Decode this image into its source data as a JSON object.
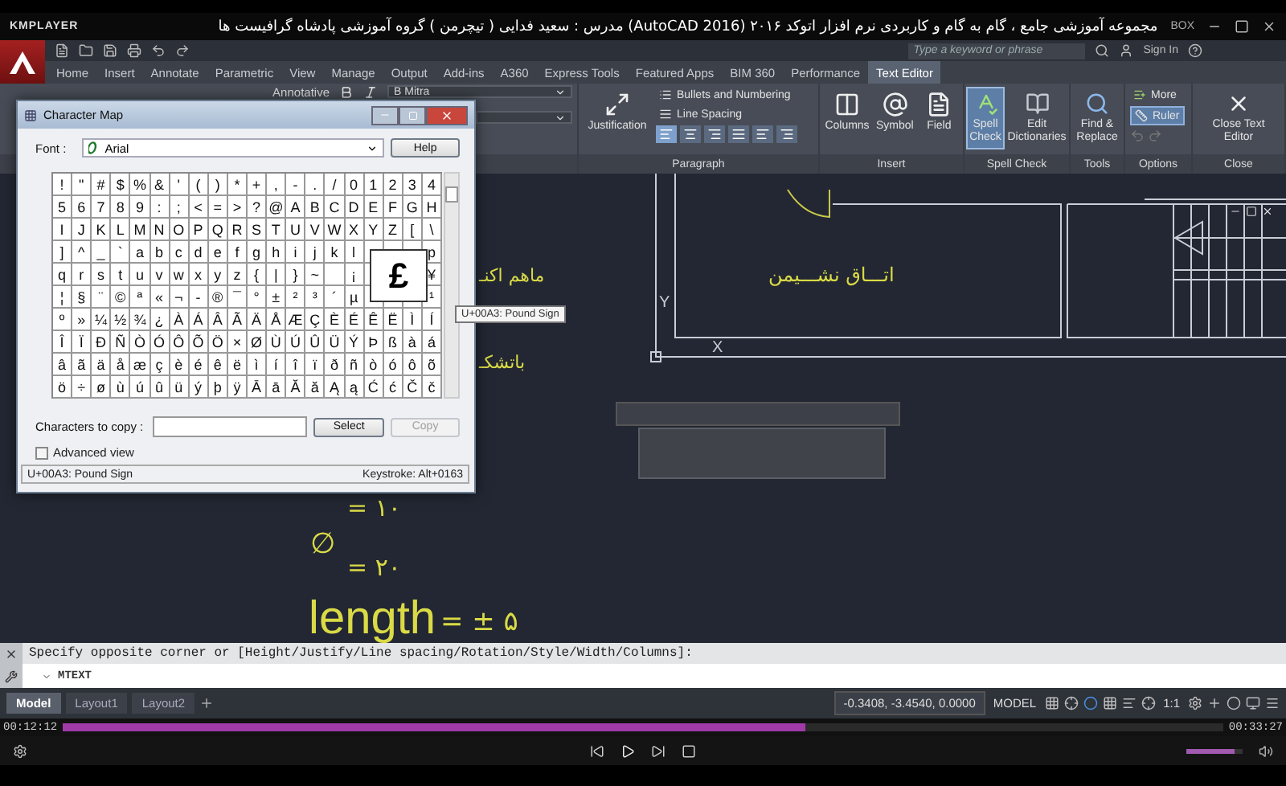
{
  "player": {
    "brand": "KMPLAYER",
    "title": "مجموعه آموزشی جامع ، گام به گام و کاربردی نرم افزار  اتوکد ۲۰۱۶ (AutoCAD 2016)  مدرس : سعید فدایی ( تیچرمن ) گروه آموزشی پادشاه گرافیست ها",
    "badge": "BOX",
    "current_time": "00:12:12",
    "total_time": "00:33:27",
    "progress": {
      "level": 0.64
    },
    "volume": {
      "level": 0.85
    }
  },
  "autocad_header": {
    "search": {
      "placeholder": "Type a keyword or phrase"
    },
    "sign_in": "Sign In"
  },
  "ribbon_tabs": [
    {
      "label": "Home",
      "selected": false
    },
    {
      "label": "Insert",
      "selected": false
    },
    {
      "label": "Annotate",
      "selected": false
    },
    {
      "label": "Parametric",
      "selected": false
    },
    {
      "label": "View",
      "selected": false
    },
    {
      "label": "Manage",
      "selected": false
    },
    {
      "label": "Output",
      "selected": false
    },
    {
      "label": "Add-ins",
      "selected": false
    },
    {
      "label": "A360",
      "selected": false
    },
    {
      "label": "Express Tools",
      "selected": false
    },
    {
      "label": "Featured Apps",
      "selected": false
    },
    {
      "label": "BIM 360",
      "selected": false
    },
    {
      "label": "Performance",
      "selected": false
    },
    {
      "label": "Text Editor",
      "selected": true
    }
  ],
  "ribbon": {
    "formatting": {
      "annotative": "Annotative",
      "font": "B Mitra"
    },
    "paragraph": {
      "title": "Paragraph",
      "justification": "Justification",
      "bullets": "Bullets and Numbering",
      "line_spacing": "Line Spacing",
      "alignments": [
        {
          "selected": true
        },
        {
          "selected": false
        },
        {
          "selected": false
        },
        {
          "selected": false
        },
        {
          "selected": false
        },
        {
          "selected": false
        }
      ]
    },
    "insert": {
      "title": "Insert",
      "buttons": [
        "Columns",
        "Symbol",
        "Field"
      ]
    },
    "spell_check": {
      "title": "Spell Check",
      "buttons": [
        {
          "label": "Spell Check",
          "selected": true
        },
        {
          "label": "Edit Dictionaries",
          "selected": false
        }
      ]
    },
    "tools": {
      "title": "Tools",
      "button": "Find & Replace"
    },
    "options": {
      "title": "Options",
      "more": "More",
      "ruler": {
        "label": "Ruler",
        "on": true
      }
    },
    "close": {
      "title": "Close",
      "button": "Close Text Editor"
    }
  },
  "drawing": {
    "room_label": "اتـــاق نشـــیمن",
    "side_texts": [
      "ماهم اکنـ",
      "باتشکـ"
    ],
    "ucs": {
      "y": "Y",
      "x": "X"
    },
    "values": [
      {
        "kind": "text",
        "text": "= ۱۰"
      },
      {
        "kind": "diameter",
        "symbol": "∅",
        "text": "= ۲۰"
      }
    ],
    "length": {
      "word": "length",
      "text": "= ± ۵"
    }
  },
  "character_map": {
    "title": "Character Map",
    "font_label": "Font :",
    "font": "Arial",
    "help": "Help",
    "rows": [
      [
        "!",
        "\"",
        "#",
        "$",
        "%",
        "&",
        "'",
        "(",
        ")",
        "*",
        "+",
        ",",
        "-",
        ".",
        "/",
        "0",
        "1",
        "2",
        "3",
        "4"
      ],
      [
        "5",
        "6",
        "7",
        "8",
        "9",
        ":",
        ";",
        "<",
        "=",
        ">",
        "?",
        "@",
        "A",
        "B",
        "C",
        "D",
        "E",
        "F",
        "G",
        "H"
      ],
      [
        "I",
        "J",
        "K",
        "L",
        "M",
        "N",
        "O",
        "P",
        "Q",
        "R",
        "S",
        "T",
        "U",
        "V",
        "W",
        "X",
        "Y",
        "Z",
        "[",
        "\\"
      ],
      [
        "]",
        "^",
        "_",
        "`",
        "a",
        "b",
        "c",
        "d",
        "e",
        "f",
        "g",
        "h",
        "i",
        "j",
        "k",
        "l",
        null,
        null,
        null,
        "p"
      ],
      [
        "q",
        "r",
        "s",
        "t",
        "u",
        "v",
        "w",
        "x",
        "y",
        "z",
        "{",
        "|",
        "}",
        "~",
        null,
        "¡",
        null,
        null,
        null,
        "¥"
      ],
      [
        "¦",
        "§",
        "¨",
        "©",
        "ª",
        "«",
        "¬",
        "-",
        "®",
        "¯",
        "°",
        "±",
        "²",
        "³",
        "´",
        "µ",
        null,
        null,
        null,
        "¹"
      ],
      [
        "º",
        "»",
        "¼",
        "½",
        "¾",
        "¿",
        "À",
        "Á",
        "Â",
        "Ã",
        "Ä",
        "Å",
        "Æ",
        "Ç",
        "È",
        "É",
        "Ê",
        "Ë",
        "Ì",
        "Í"
      ],
      [
        "Î",
        "Ï",
        "Ð",
        "Ñ",
        "Ò",
        "Ó",
        "Ô",
        "Õ",
        "Ö",
        "×",
        "Ø",
        "Ù",
        "Ú",
        "Û",
        "Ü",
        "Ý",
        "Þ",
        "ß",
        "à",
        "á"
      ],
      [
        "â",
        "ã",
        "ä",
        "å",
        "æ",
        "ç",
        "è",
        "é",
        "ê",
        "ë",
        "ì",
        "í",
        "î",
        "ï",
        "ð",
        "ñ",
        "ò",
        "ó",
        "ô",
        "õ"
      ],
      [
        "ö",
        "÷",
        "ø",
        "ù",
        "ú",
        "û",
        "ü",
        "ý",
        "þ",
        "ÿ",
        "Ā",
        "ā",
        "Ă",
        "ă",
        "Ą",
        "ą",
        "Ć",
        "ć",
        "Č",
        "č"
      ]
    ],
    "magnified": "£",
    "tooltip": "U+00A3: Pound Sign",
    "copy_label": "Characters to copy :",
    "select": "Select",
    "copy": {
      "label": "Copy",
      "disabled": true
    },
    "advanced_view": {
      "label": "Advanced view",
      "checked": false
    },
    "status": "U+00A3: Pound Sign",
    "keystroke": "Keystroke: Alt+0163"
  },
  "command_line": {
    "history": "Specify opposite corner or [Height/Justify/Line spacing/Rotation/Style/Width/Columns]:",
    "input": "MTEXT"
  },
  "status_bar": {
    "layout_tabs": [
      {
        "label": "Model",
        "selected": true
      },
      {
        "label": "Layout1",
        "selected": false
      },
      {
        "label": "Layout2",
        "selected": false
      }
    ],
    "coordinates": "-0.3408, -3.4540, 0.0000",
    "space": "MODEL",
    "scale": "1:1"
  }
}
